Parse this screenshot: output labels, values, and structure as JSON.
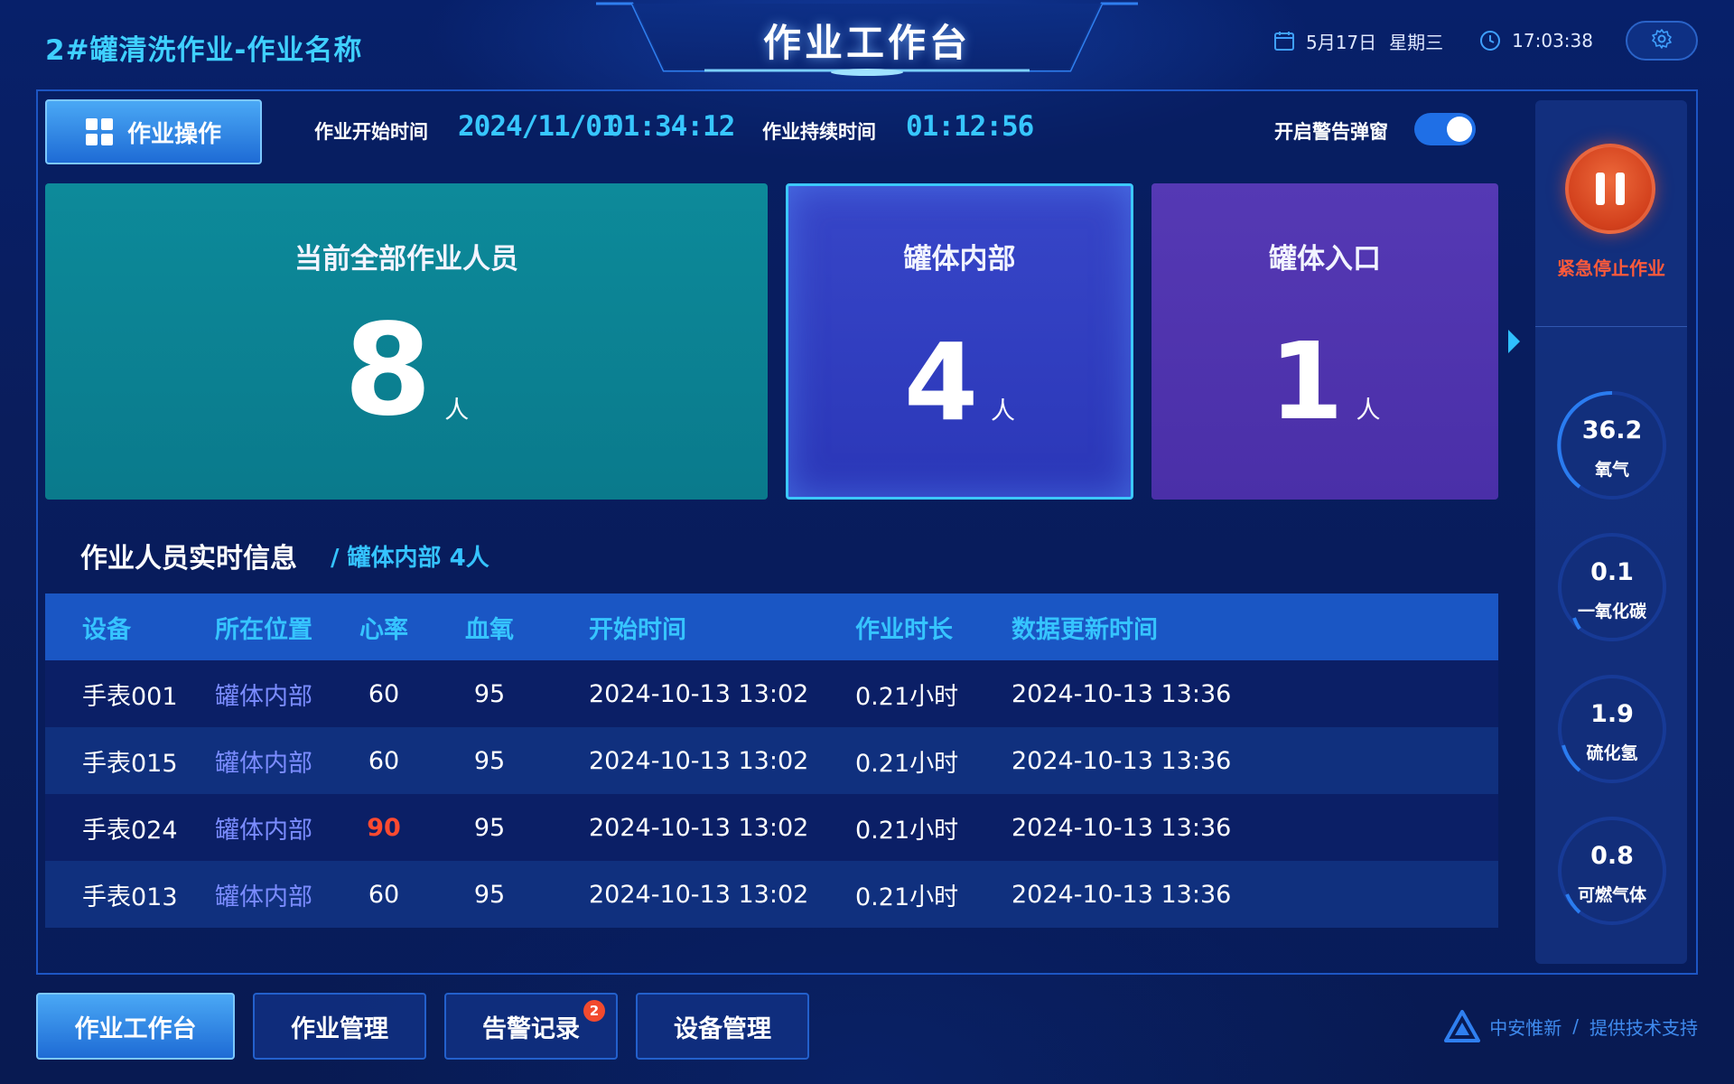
{
  "header": {
    "app_title": "2#罐清洗作业-作业名称",
    "center_title": "作业工作台",
    "date": "5月17日",
    "weekday": "星期三",
    "time": "17:03:38"
  },
  "toolbar": {
    "ops_button": "作业操作",
    "start_time_label": "作业开始时间",
    "start_date": "2024/11/01",
    "start_time": "01:34:12",
    "duration_label": "作业持续时间",
    "duration": "01:12:56",
    "alert_popup_label": "开启警告弹窗",
    "alert_popup_on": true
  },
  "cards": {
    "total": {
      "title": "当前全部作业人员",
      "count": "8",
      "unit": "人"
    },
    "inside": {
      "title": "罐体内部",
      "count": "4",
      "unit": "人"
    },
    "entrance": {
      "title": "罐体入口",
      "count": "1",
      "unit": "人"
    }
  },
  "section": {
    "title": "作业人员实时信息",
    "subtitle": "/  罐体内部  4人"
  },
  "table": {
    "headers": [
      "设备",
      "所在位置",
      "心率",
      "血氧",
      "开始时间",
      "作业时长",
      "数据更新时间"
    ],
    "rows": [
      [
        "手表001",
        "罐体内部",
        "60",
        "95",
        "2024-10-13 13:02",
        "0.21小时",
        "2024-10-13 13:36"
      ],
      [
        "手表015",
        "罐体内部",
        "60",
        "95",
        "2024-10-13 13:02",
        "0.21小时",
        "2024-10-13 13:36"
      ],
      [
        "手表024",
        "罐体内部",
        "90",
        "95",
        "2024-10-13 13:02",
        "0.21小时",
        "2024-10-13 13:36"
      ],
      [
        "手表013",
        "罐体内部",
        "60",
        "95",
        "2024-10-13 13:02",
        "0.21小时",
        "2024-10-13 13:36"
      ]
    ]
  },
  "sidebar": {
    "estop_label": "紧急停止作业",
    "gauges": [
      {
        "value": "36.2",
        "name": "氧气"
      },
      {
        "value": "0.1",
        "name": "一氧化碳"
      },
      {
        "value": "1.9",
        "name": "硫化氢"
      },
      {
        "value": "0.8",
        "name": "可燃气体"
      }
    ]
  },
  "nav": {
    "items": [
      {
        "label": "作业工作台"
      },
      {
        "label": "作业管理"
      },
      {
        "label": "告警记录",
        "badge": "2"
      },
      {
        "label": "设备管理"
      }
    ]
  },
  "footer": {
    "company": "中安惟新",
    "separator": "/",
    "support": "提供技术支持"
  },
  "colors": {
    "accent": "#37c7ff",
    "danger": "#ff4a30",
    "card_total": "#0d8a9a",
    "card_inside": "#3746c8",
    "card_entrance": "#5539b4"
  }
}
